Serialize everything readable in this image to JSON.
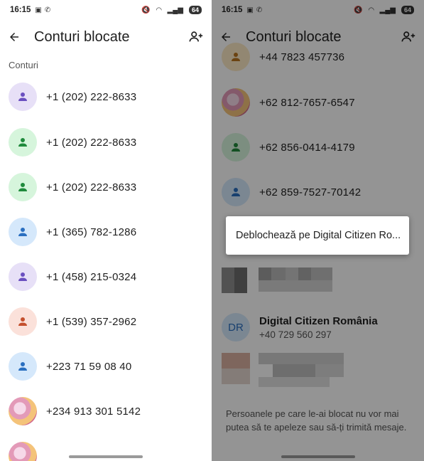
{
  "left": {
    "status": {
      "time": "16:15",
      "battery": "64"
    },
    "title": "Conturi blocate",
    "section": "Conturi",
    "rows": [
      {
        "number": "+1 (202) 222-8633",
        "avatar_bg": "#e7e0f7",
        "icon_color": "#6a4fc0"
      },
      {
        "number": "+1 (202) 222-8633",
        "avatar_bg": "#d6f5dc",
        "icon_color": "#1f8a3c"
      },
      {
        "number": "+1 (202) 222-8633",
        "avatar_bg": "#d6f5dc",
        "icon_color": "#1f8a3c"
      },
      {
        "number": "+1 (365) 782-1286",
        "avatar_bg": "#d5e8fb",
        "icon_color": "#2a6fc0"
      },
      {
        "number": "+1 (458) 215-0324",
        "avatar_bg": "#e7e0f7",
        "icon_color": "#6a4fc0"
      },
      {
        "number": "+1 (539) 357-2962",
        "avatar_bg": "#fbe1da",
        "icon_color": "#c4502e"
      },
      {
        "number": "+223 71 59 08 40",
        "avatar_bg": "#d5e8fb",
        "icon_color": "#2a6fc0"
      },
      {
        "number": "+234 913 301 5142",
        "avatar_bg": "photo",
        "icon_color": ""
      }
    ]
  },
  "right": {
    "status": {
      "time": "16:15",
      "battery": "64"
    },
    "title": "Conturi blocate",
    "rows": [
      {
        "number": "+44 7823 457736"
      },
      {
        "number": "+62 812-7657-6547"
      },
      {
        "number": "+62 856-0414-4179"
      },
      {
        "number": "+62 859-7527-70142"
      }
    ],
    "dialog_text": "Deblochează pe Digital Citizen Ro...",
    "contact": {
      "initials": "DR",
      "name": "Digital Citizen România",
      "phone": "+40 729 560 297"
    },
    "footer": "Persoanele pe care le-ai blocat nu vor mai putea să te apeleze sau să-ți trimită mesaje."
  }
}
